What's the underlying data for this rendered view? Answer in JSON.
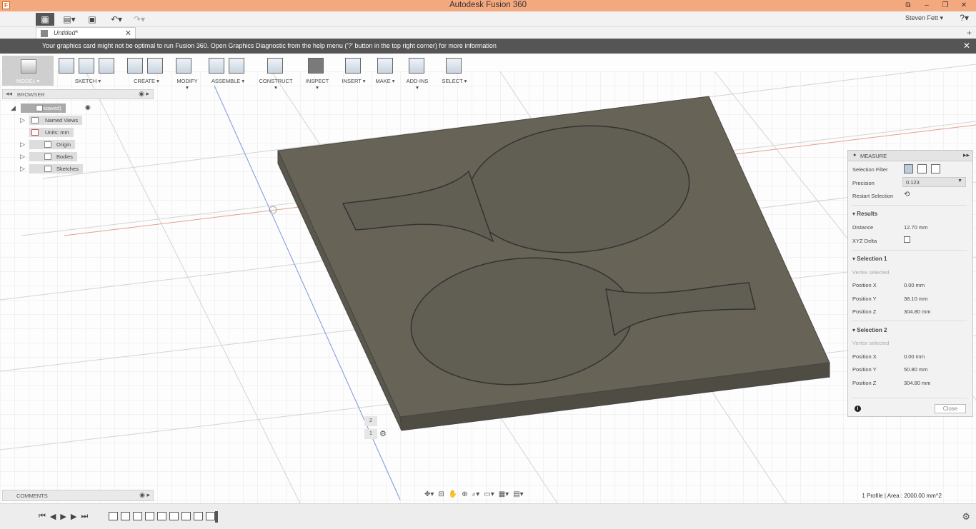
{
  "window": {
    "title": "Autodesk Fusion 360",
    "app_icon": "F",
    "controls": [
      "⧉",
      "–",
      "❐",
      "✕"
    ]
  },
  "appbar": {
    "user": "Steven Fett ▾",
    "help": "?▾",
    "grid_icon": "▦",
    "file_icon": "▤▾",
    "save_icon": "▣",
    "undo_icon": "↶▾",
    "redo_icon": "↷▾"
  },
  "tabs": [
    {
      "label": "Untitled*",
      "close": "✕"
    }
  ],
  "new_tab": "+",
  "notice": {
    "message": "Your graphics card might not be optimal to run Fusion 360. Open Graphics Diagnostic from the help menu ('?' button in the top right corner) for more information",
    "close": "✕"
  },
  "toolbar": {
    "model": "MODEL ▾",
    "groups": [
      {
        "label": "SKETCH ▾"
      },
      {
        "label": "CREATE ▾"
      },
      {
        "label": "MODIFY ▾"
      },
      {
        "label": "ASSEMBLE ▾"
      },
      {
        "label": "CONSTRUCT ▾"
      },
      {
        "label": "INSPECT ▾"
      },
      {
        "label": "INSERT ▾"
      },
      {
        "label": "MAKE ▾"
      },
      {
        "label": "ADD-INS ▾"
      },
      {
        "label": "SELECT ▾"
      }
    ]
  },
  "browser": {
    "title": "BROWSER",
    "collapse": "◂◂",
    "control": "◉ ▸",
    "items": [
      {
        "label": "(Unsaved)"
      },
      {
        "label": "Named Views"
      },
      {
        "label": "Units: mm"
      },
      {
        "label": "Origin"
      },
      {
        "label": "Bodies"
      },
      {
        "label": "Sketches"
      }
    ]
  },
  "comments": {
    "title": "COMMENTS",
    "control": "◉ ▸"
  },
  "measure": {
    "title": "MEASURE",
    "selection_filter": "Selection Filter",
    "precision_label": "Precision",
    "precision_value": "0.123",
    "restart_selection": "Restart Selection",
    "results": {
      "title": "Results",
      "distance_label": "Distance",
      "distance_value": "12.70 mm",
      "xyz_delta_label": "XYZ Delta"
    },
    "selection1": {
      "title": "Selection 1",
      "status": "Vertex selected",
      "x_label": "Position X",
      "x_value": "0.00 mm",
      "y_label": "Position Y",
      "y_value": "38.10 mm",
      "z_label": "Position Z",
      "z_value": "304.80 mm"
    },
    "selection2": {
      "title": "Selection 2",
      "status": "Vertex selected",
      "x_label": "Position X",
      "x_value": "0.00 mm",
      "y_label": "Position Y",
      "y_value": "50.80 mm",
      "z_label": "Position Z",
      "z_value": "304.80 mm"
    },
    "close": "Close"
  },
  "viewport": {
    "tag_2": "2",
    "tag_1": "1",
    "status": "1 Profile | Area : 2000.00 mm^2",
    "nav_icons": [
      "✥▾",
      "⊟",
      "✋",
      "⊕",
      "⌕▾",
      "▭▾",
      "▦▾",
      "▤▾"
    ]
  },
  "timeline": {
    "controls": [
      "⏮",
      "◀",
      "▶",
      "▶",
      "⏭"
    ],
    "gear": "⚙"
  },
  "colors": {
    "titlebar": "#f4a87e",
    "model_body": "#676357",
    "notice_bg": "#555555"
  }
}
